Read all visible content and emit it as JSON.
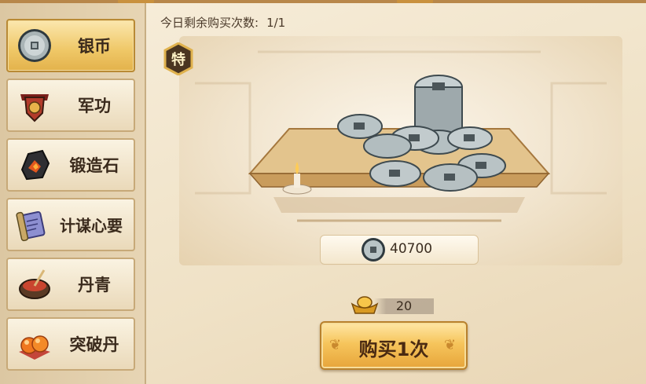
{
  "sidebar": {
    "items": [
      {
        "label": "银币",
        "icon": "silver-coin-icon",
        "active": true
      },
      {
        "label": "军功",
        "icon": "military-merit-icon",
        "active": false
      },
      {
        "label": "锻造石",
        "icon": "forging-stone-icon",
        "active": false
      },
      {
        "label": "计谋心要",
        "icon": "strategy-scroll-icon",
        "active": false
      },
      {
        "label": "丹青",
        "icon": "paint-bowl-icon",
        "active": false
      },
      {
        "label": "突破丹",
        "icon": "breakthrough-pill-icon",
        "active": false
      }
    ]
  },
  "main": {
    "buy_count_label": "今日剩余购买次数:",
    "buy_count_value": "1/1",
    "special_badge": "特",
    "reward_amount": "40700",
    "cost_value": "20",
    "buy_button_label": "购买1次"
  },
  "colors": {
    "accent_gold": "#efc766",
    "panel_bg": "#efe3c8",
    "text_dark": "#3a2a1c"
  }
}
